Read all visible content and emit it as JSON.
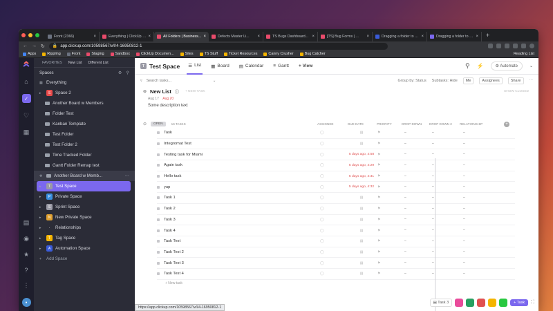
{
  "browser": {
    "tabs": [
      {
        "title": "Front (2366)",
        "color": "#6b7280",
        "active": false
      },
      {
        "title": "Everything | ClickUp 2...",
        "color": "#e94b6b",
        "active": false
      },
      {
        "title": "All Folders | Business...",
        "color": "#e94b6b",
        "active": true
      },
      {
        "title": "Defects Master Li...",
        "color": "#e94b6b",
        "active": false
      },
      {
        "title": "TS Bugs Dashboard...",
        "color": "#e94b6b",
        "active": false
      },
      {
        "title": "[TS] Bug Forms | ...",
        "color": "#e94b6b",
        "active": false
      },
      {
        "title": "Dragging a folder to n...",
        "color": "#3a5bd9",
        "active": false
      },
      {
        "title": "Dragging a folder to n...",
        "color": "#7b68ee",
        "active": false
      }
    ],
    "url": "app.clickup.com/10598567/v/l/4-16950812-1",
    "bookmarks": [
      {
        "label": "Apps",
        "color": "#4285f4"
      },
      {
        "label": "Rippling",
        "color": "#f4b400"
      },
      {
        "label": "Front",
        "color": "#6b7280"
      },
      {
        "label": "Staging",
        "color": "#e94b6b"
      },
      {
        "label": "Sandbox",
        "color": "#e94b6b"
      },
      {
        "label": "ClickUp Documen...",
        "color": "#e94b6b"
      },
      {
        "label": "Sites",
        "color": "#f4b400"
      },
      {
        "label": "TS Stuff",
        "color": "#f4b400"
      },
      {
        "label": "Ticket Resources",
        "color": "#f4b400"
      },
      {
        "label": "Canny Crusher",
        "color": "#f4b400"
      },
      {
        "label": "Bug Catcher",
        "color": "#f4b400"
      }
    ],
    "reading_list": "Reading List",
    "status_url": "https://app.clickup.com/10598567/v/l/4-16950812-1"
  },
  "sidebar": {
    "favorites_label": "FAVORITES",
    "favorites": [
      "New List",
      "Different List"
    ],
    "spaces_label": "Spaces",
    "items": [
      {
        "label": "Everything",
        "kind": "everything"
      },
      {
        "label": "Space 2",
        "kind": "space",
        "badge": "S",
        "color": "#e94b4b"
      },
      {
        "label": "Another Board w Members",
        "kind": "folder"
      },
      {
        "label": "Folder Test",
        "kind": "folder"
      },
      {
        "label": "Kanban Template",
        "kind": "folder"
      },
      {
        "label": "Test Folder",
        "kind": "folder"
      },
      {
        "label": "Test Folder 2",
        "kind": "folder"
      },
      {
        "label": "Time Tracked Folder",
        "kind": "folder"
      },
      {
        "label": "Gantt Folder Remap test",
        "kind": "folder"
      },
      {
        "label": "Another Board w Memb...",
        "kind": "drag"
      },
      {
        "label": "Test Space",
        "kind": "space",
        "badge": "T",
        "color": "#9a9aa5",
        "active": true
      },
      {
        "label": "Private Space",
        "kind": "space",
        "badge": "P",
        "color": "#3a8fe0"
      },
      {
        "label": "Sprint Space",
        "kind": "space",
        "badge": "S",
        "color": "#9a9aa5"
      },
      {
        "label": "New Private Space",
        "kind": "space",
        "badge": "N",
        "color": "#e0a030"
      },
      {
        "label": "Relationships",
        "kind": "space",
        "badge": "·",
        "color": "#2b2c37"
      },
      {
        "label": "Tag Space",
        "kind": "space",
        "badge": "T",
        "color": "#f4b400"
      },
      {
        "label": "Automation Space",
        "kind": "space",
        "badge": "A",
        "color": "#3a5bd9"
      },
      {
        "label": "Add Space",
        "kind": "add"
      }
    ]
  },
  "header": {
    "space_title": "Test Space",
    "space_badge": "T",
    "views": [
      "List",
      "Board",
      "Calendar",
      "Gantt"
    ],
    "add_view": "+ View",
    "automate": "Automate",
    "search_placeholder": "Search tasks...",
    "group_by": "Group by: Status",
    "subtasks": "Subtasks: Hide",
    "me": "Me",
    "assignees": "Assignees",
    "share": "Share"
  },
  "list": {
    "name": "New List",
    "new_task_label": "+ NEW TASK",
    "show_closed": "SHOW CLOSED",
    "start_date": "Aug 17",
    "due_date": "Aug 20",
    "description": "Some description text",
    "status": "OPEN",
    "task_count": "16 TASKS",
    "columns": [
      "ASSIGNEE",
      "DUE DATE",
      "PRIORITY",
      "DROP DOWN",
      "DROP DOWN 2",
      "RELATIONSHIP"
    ],
    "tasks": [
      {
        "name": "Task",
        "due": "",
        "dd": "–",
        "dd2": "–",
        "rel": "–"
      },
      {
        "name": "Integromat Test",
        "due": "",
        "dd": "–",
        "dd2": "–",
        "rel": "–"
      },
      {
        "name": "Testing task for Miami",
        "due": "5 days ago, 4:58",
        "dd": "–",
        "dd2": "–",
        "rel": "–"
      },
      {
        "name": "Again task",
        "due": "5 days ago, 4:29",
        "dd": "–",
        "dd2": "–",
        "rel": "–"
      },
      {
        "name": "Hello task",
        "due": "5 days ago, 4:31",
        "dd": "–",
        "dd2": "–",
        "rel": "–"
      },
      {
        "name": "yup",
        "due": "5 days ago, 4:32",
        "dd": "–",
        "dd2": "–",
        "rel": "–"
      },
      {
        "name": "Task 1",
        "due": "",
        "dd": "–",
        "dd2": "–",
        "rel": "–"
      },
      {
        "name": "Task 2",
        "due": "",
        "dd": "–",
        "dd2": "–",
        "rel": "–"
      },
      {
        "name": "Task 3",
        "due": "",
        "dd": "–",
        "dd2": "–",
        "rel": "–"
      },
      {
        "name": "Task 4",
        "due": "",
        "dd": "–",
        "dd2": "–",
        "rel": "–"
      },
      {
        "name": "Task Test",
        "due": "",
        "dd": "–",
        "dd2": "–",
        "rel": "–"
      },
      {
        "name": "Task Test 2",
        "due": "",
        "dd": "–",
        "dd2": "–",
        "rel": "–"
      },
      {
        "name": "Task Test 3",
        "due": "",
        "dd": "–",
        "dd2": "–",
        "rel": "–"
      },
      {
        "name": "Task Test 4",
        "due": "",
        "dd": "–",
        "dd2": "–",
        "rel": "–"
      }
    ],
    "add_task": "+ New task"
  },
  "footer": {
    "tray_task": "Task 3",
    "add_task_button": "+ Task"
  },
  "colors": {
    "accent": "#7b68ee",
    "overdue": "#e05050"
  }
}
